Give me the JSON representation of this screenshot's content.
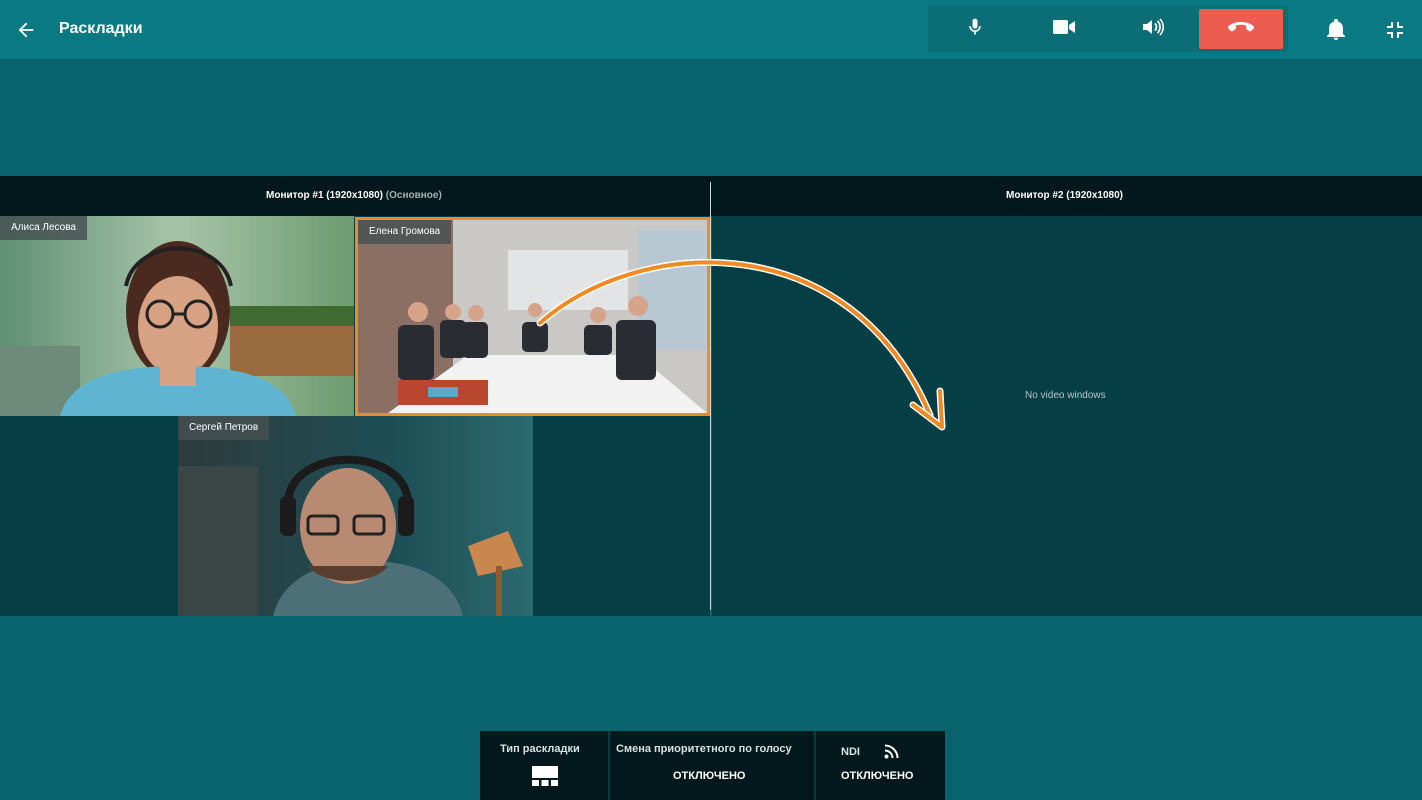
{
  "header": {
    "title": "Раскладки",
    "back_icon": "arrow-left-icon"
  },
  "controls": {
    "mic_icon": "microphone-icon",
    "camera_icon": "video-camera-icon",
    "speaker_icon": "speaker-volume-icon",
    "hangup_icon": "hang-up-phone-icon",
    "hangup_color": "#ec5c50",
    "bell_icon": "bell-icon",
    "exit_fullscreen_icon": "exit-fullscreen-icon"
  },
  "monitors": [
    {
      "title": "Монитор #1 (1920x1080)",
      "subtitle": "(Основное)",
      "tiles": [
        {
          "name": "Алиса Лесова"
        },
        {
          "name": "Елена Громова",
          "highlight_color": "#f08a24"
        },
        {
          "name": "Сергей Петров"
        }
      ]
    },
    {
      "title": "Монитор #2 (1920x1080)",
      "empty_text": "No video windows"
    }
  ],
  "bottom_panel": {
    "layout_type": {
      "label": "Тип раскладки",
      "icon": "layout-grid-icon"
    },
    "voice_priority": {
      "label": "Смена приоритетного по голосу",
      "value": "ОТКЛЮЧЕНО"
    },
    "ndi": {
      "label": "NDI",
      "icon": "broadcast-rss-icon",
      "value": "ОТКЛЮЧЕНО"
    }
  }
}
